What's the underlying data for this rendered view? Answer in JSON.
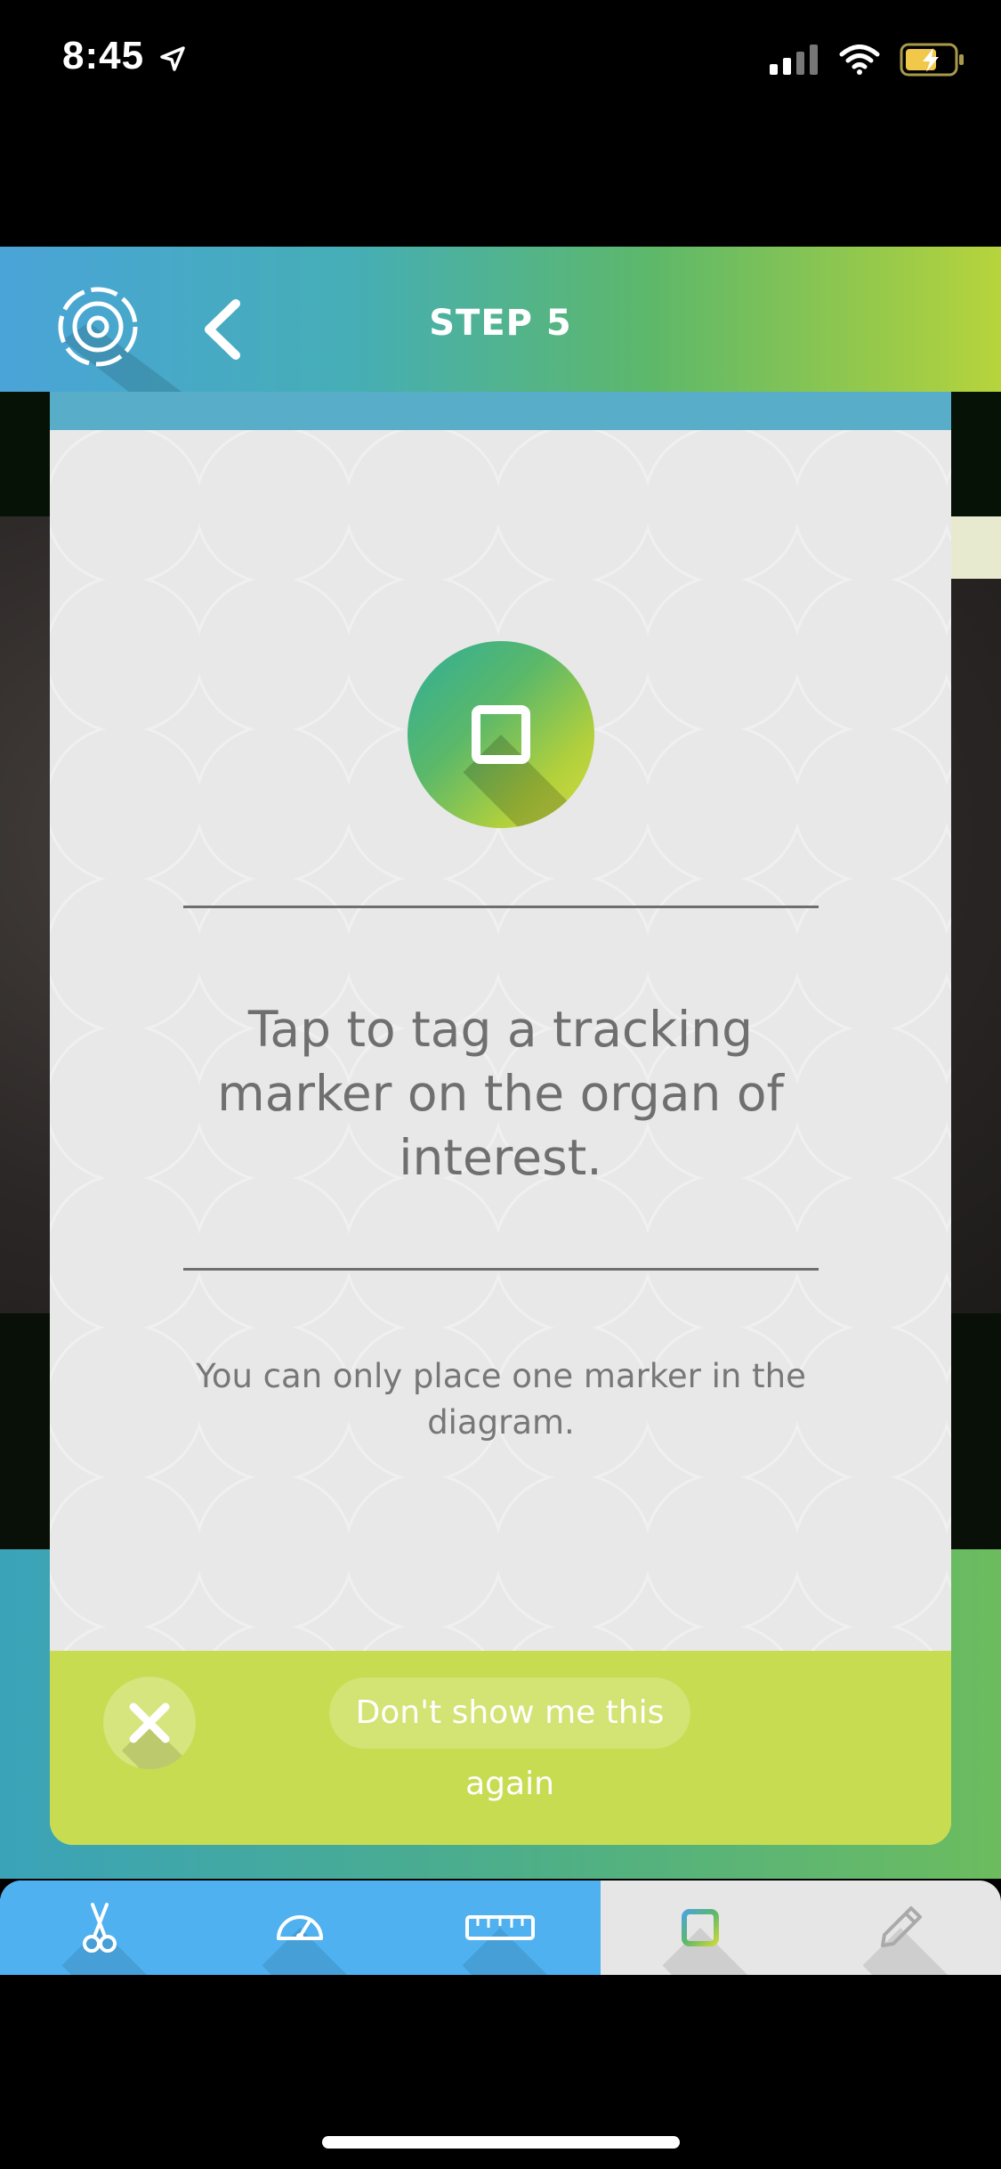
{
  "status_bar": {
    "time": "8:45",
    "icons": [
      "location-arrow-icon",
      "signal-icon",
      "wifi-icon",
      "battery-charging-icon"
    ]
  },
  "header": {
    "title": "STEP 5",
    "icons": [
      "app-logo-icon",
      "back-chevron-icon"
    ]
  },
  "tip_card": {
    "icon": "tracking-marker-icon",
    "message": "Tap to tag a tracking marker on the organ of interest.",
    "note": "You can only place one marker in the diagram.",
    "dont_show_label": "Don't show me this again",
    "close_icon": "close-icon"
  },
  "toolbar": {
    "items": [
      {
        "icon": "scissors-icon"
      },
      {
        "icon": "speedometer-icon"
      },
      {
        "icon": "ruler-icon"
      },
      {
        "icon": "marker-square-icon",
        "selected": true
      },
      {
        "icon": "pencil-icon"
      }
    ]
  },
  "colors": {
    "header_gradient_start": "#4aa4d8",
    "header_gradient_end": "#b7d43c",
    "toolbar_blue": "#4fb1ef",
    "card_footer": "#c8dc52",
    "card_top_bar": "#58adc9"
  }
}
